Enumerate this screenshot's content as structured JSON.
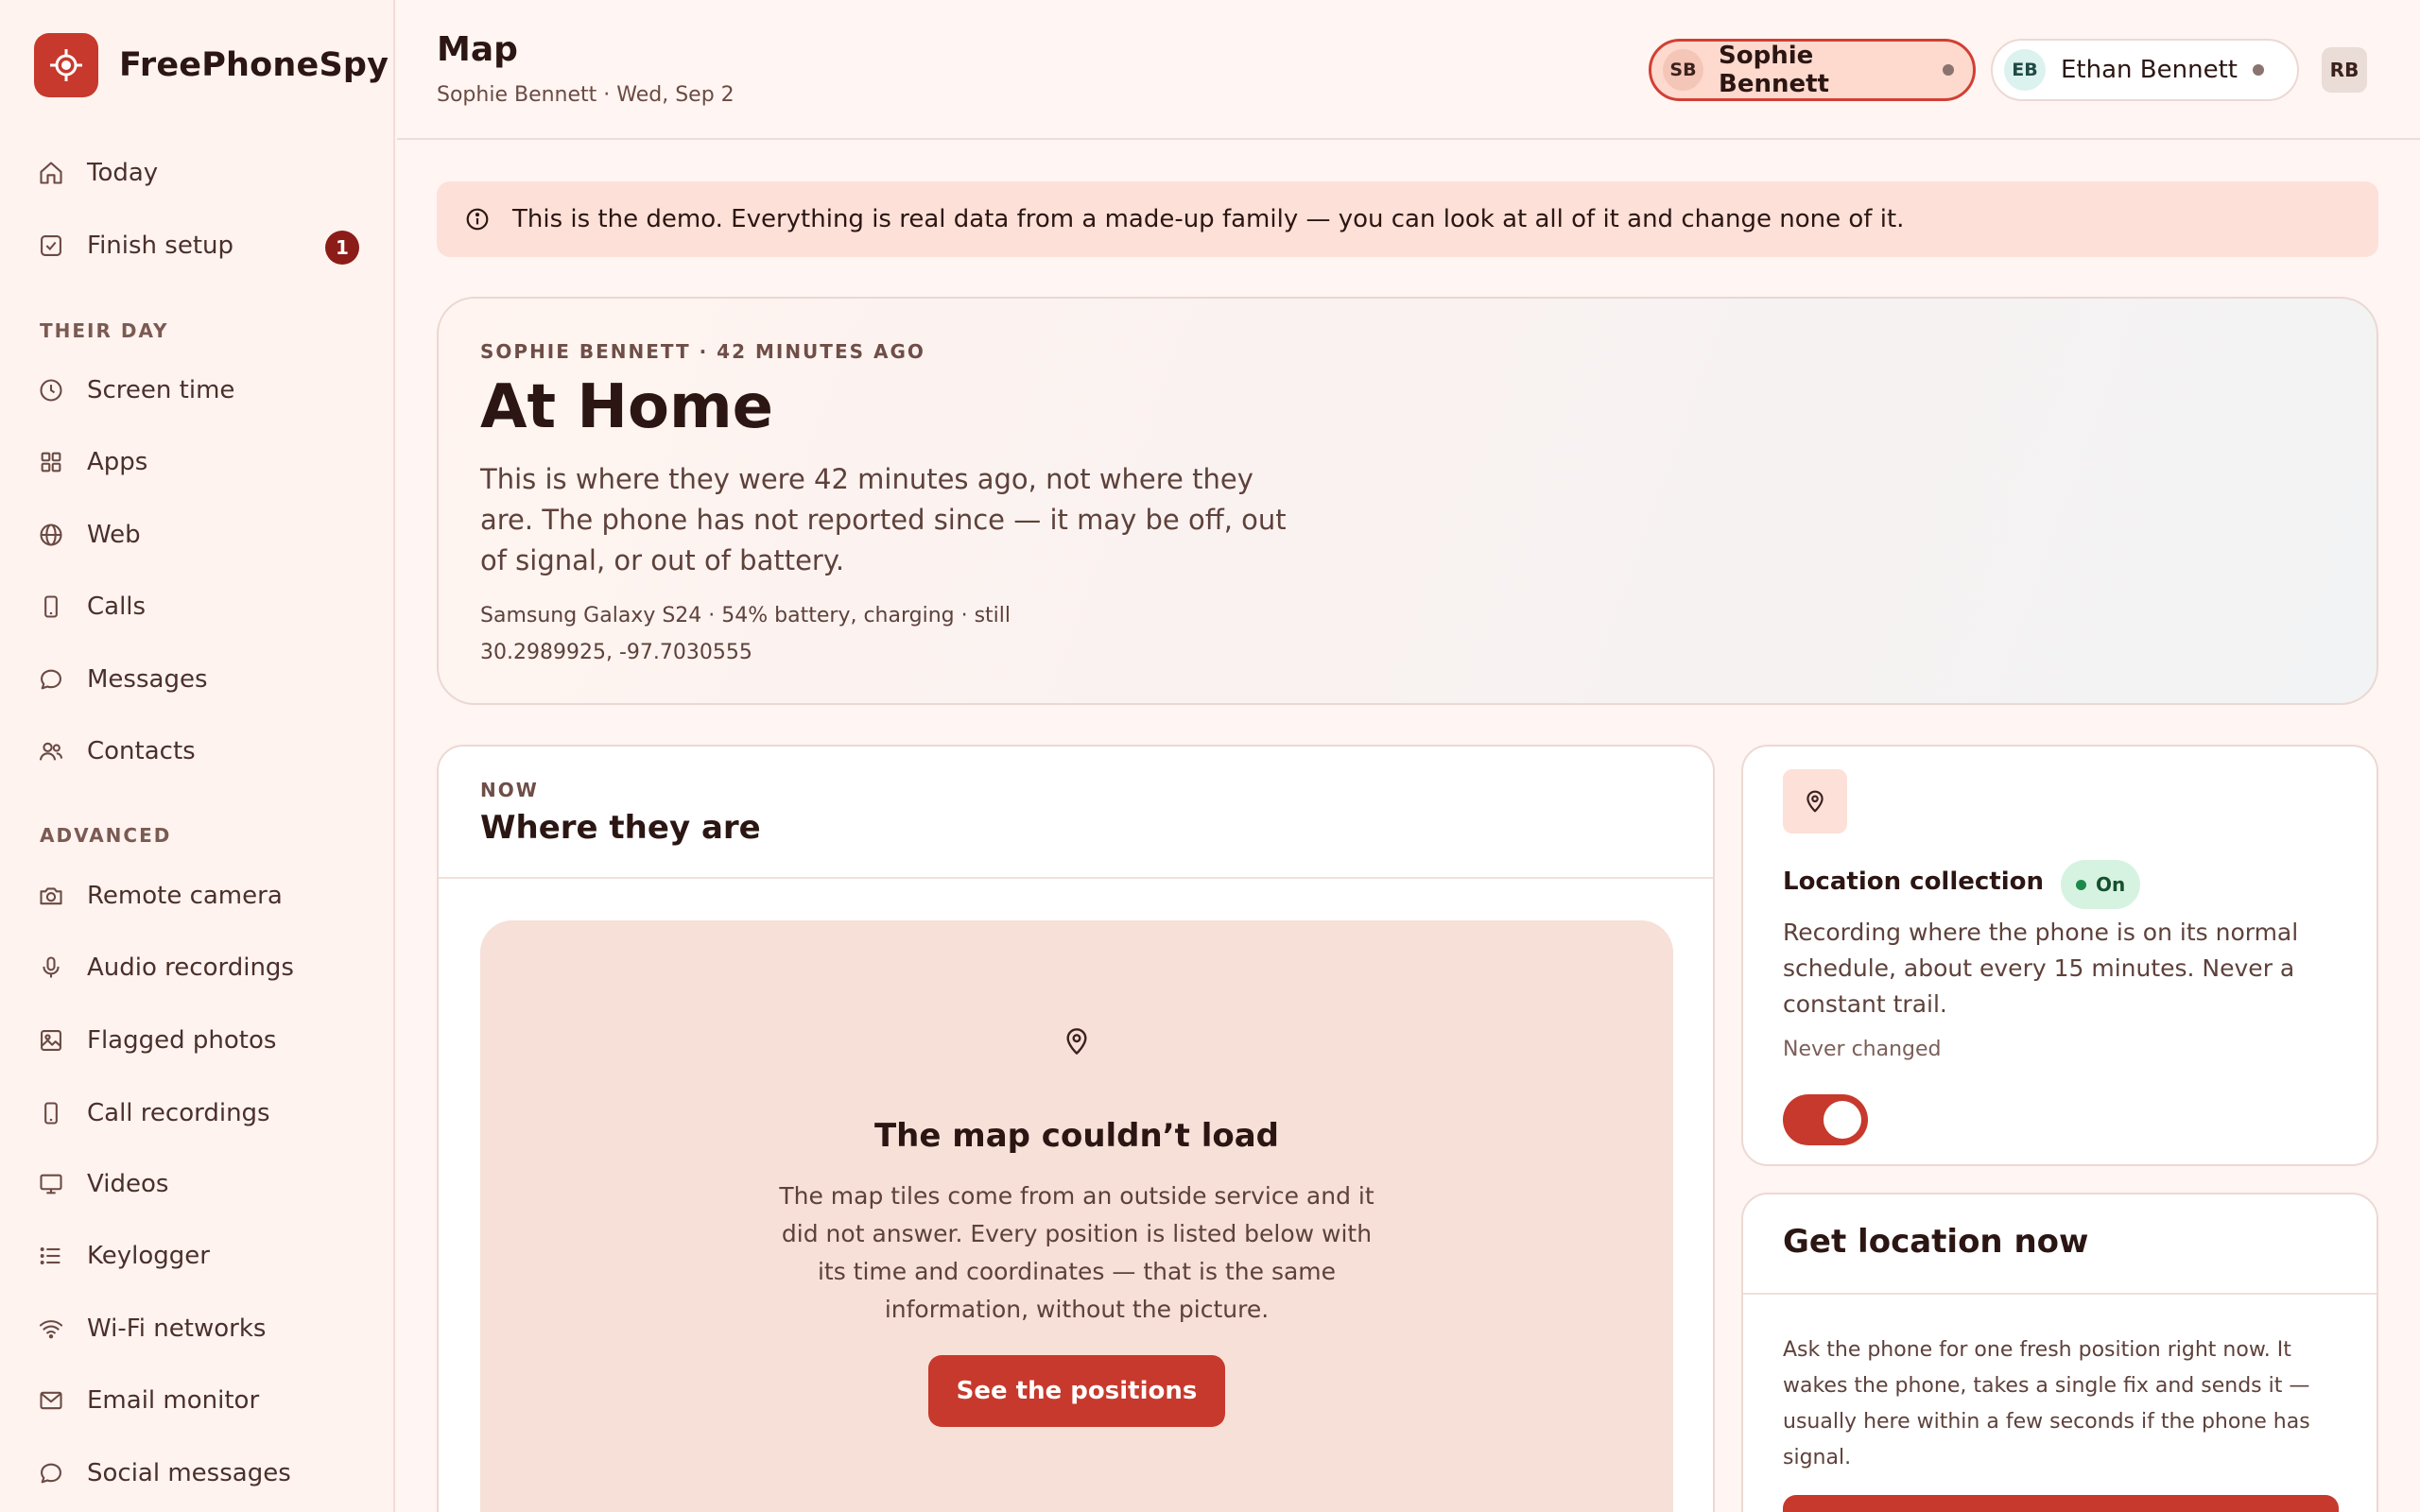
{
  "app": {
    "name": "FreePhoneSpy"
  },
  "nav": {
    "today": "Today",
    "finish_setup": "Finish setup",
    "finish_setup_badge": "1",
    "section_their_day": "THEIR DAY",
    "screen_time": "Screen time",
    "apps": "Apps",
    "web": "Web",
    "calls": "Calls",
    "messages": "Messages",
    "contacts": "Contacts",
    "section_advanced": "ADVANCED",
    "remote_camera": "Remote camera",
    "audio_recordings": "Audio recordings",
    "flagged_photos": "Flagged photos",
    "call_recordings": "Call recordings",
    "videos": "Videos",
    "keylogger": "Keylogger",
    "wifi_networks": "Wi-Fi networks",
    "email_monitor": "Email monitor",
    "social_messages": "Social messages"
  },
  "header": {
    "title": "Map",
    "subtitle": "Sophie Bennett · Wed, Sep 2",
    "profiles": [
      {
        "initials": "SB",
        "name": "Sophie Bennett"
      },
      {
        "initials": "EB",
        "name": "Ethan Bennett"
      }
    ],
    "user_initials": "RB"
  },
  "banner": {
    "text": "This is the demo. Everything is real data from a made-up family — you can look at all of it and change none of it."
  },
  "hero": {
    "eyebrow": "SOPHIE BENNETT · 42 MINUTES AGO",
    "title": "At Home",
    "description": "This is where they were 42 minutes ago, not where they are. The phone has not reported since — it may be off, out of signal, or out of battery.",
    "device_line": "Samsung Galaxy S24 · 54% battery, charging · still",
    "coordinates": "30.2989925, -97.7030555"
  },
  "map_card": {
    "eyebrow": "NOW",
    "title": "Where they are",
    "empty_title": "The map couldn’t load",
    "empty_desc": "The map tiles come from an outside service and it did not answer. Every position is listed below with its time and coordinates — that is the same information, without the picture.",
    "button": "See the positions"
  },
  "location_collection": {
    "title": "Location collection",
    "status": "On",
    "description": "Recording where the phone is on its normal schedule, about every 15 minutes. Never a constant trail.",
    "changed": "Never changed",
    "enabled": true
  },
  "get_location": {
    "title": "Get location now",
    "description": "Ask the phone for one fresh position right now. It wakes the phone, takes a single fix and sends it — usually here within a few seconds if the phone has signal."
  },
  "colors": {
    "accent": "#c7392c",
    "badge_dark": "#8c1c17",
    "banner_bg": "#fde0d7",
    "status_on_bg": "#d6f3e1"
  }
}
